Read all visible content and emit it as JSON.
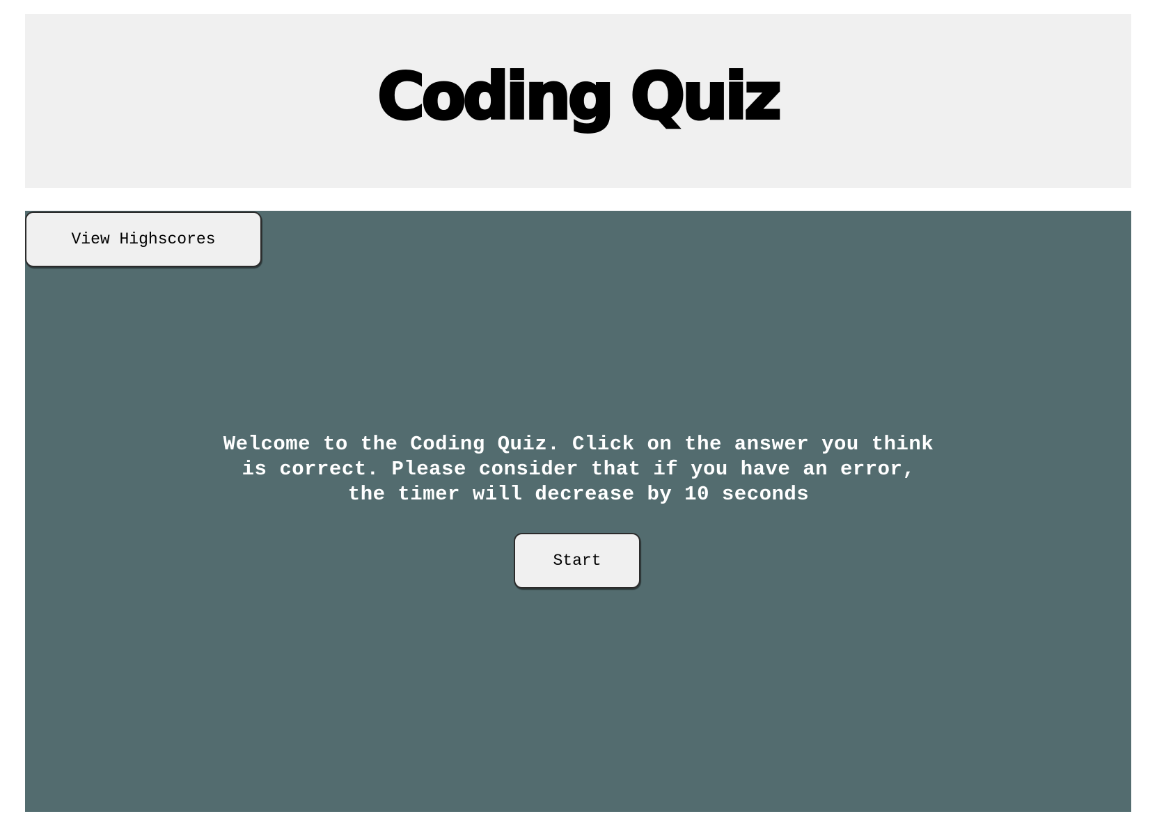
{
  "header": {
    "title": "Coding Quiz"
  },
  "nav": {
    "highscores_label": "View Highscores"
  },
  "main": {
    "intro_text": "Welcome to the Coding Quiz. Click on the answer you think is correct. Please consider that if you have an error, the timer will decrease by 10 seconds",
    "start_label": "Start"
  },
  "colors": {
    "header_bg": "#f0f0f0",
    "main_bg": "#536c6f",
    "button_bg": "#f0f0f0",
    "intro_text": "#ffffff"
  }
}
